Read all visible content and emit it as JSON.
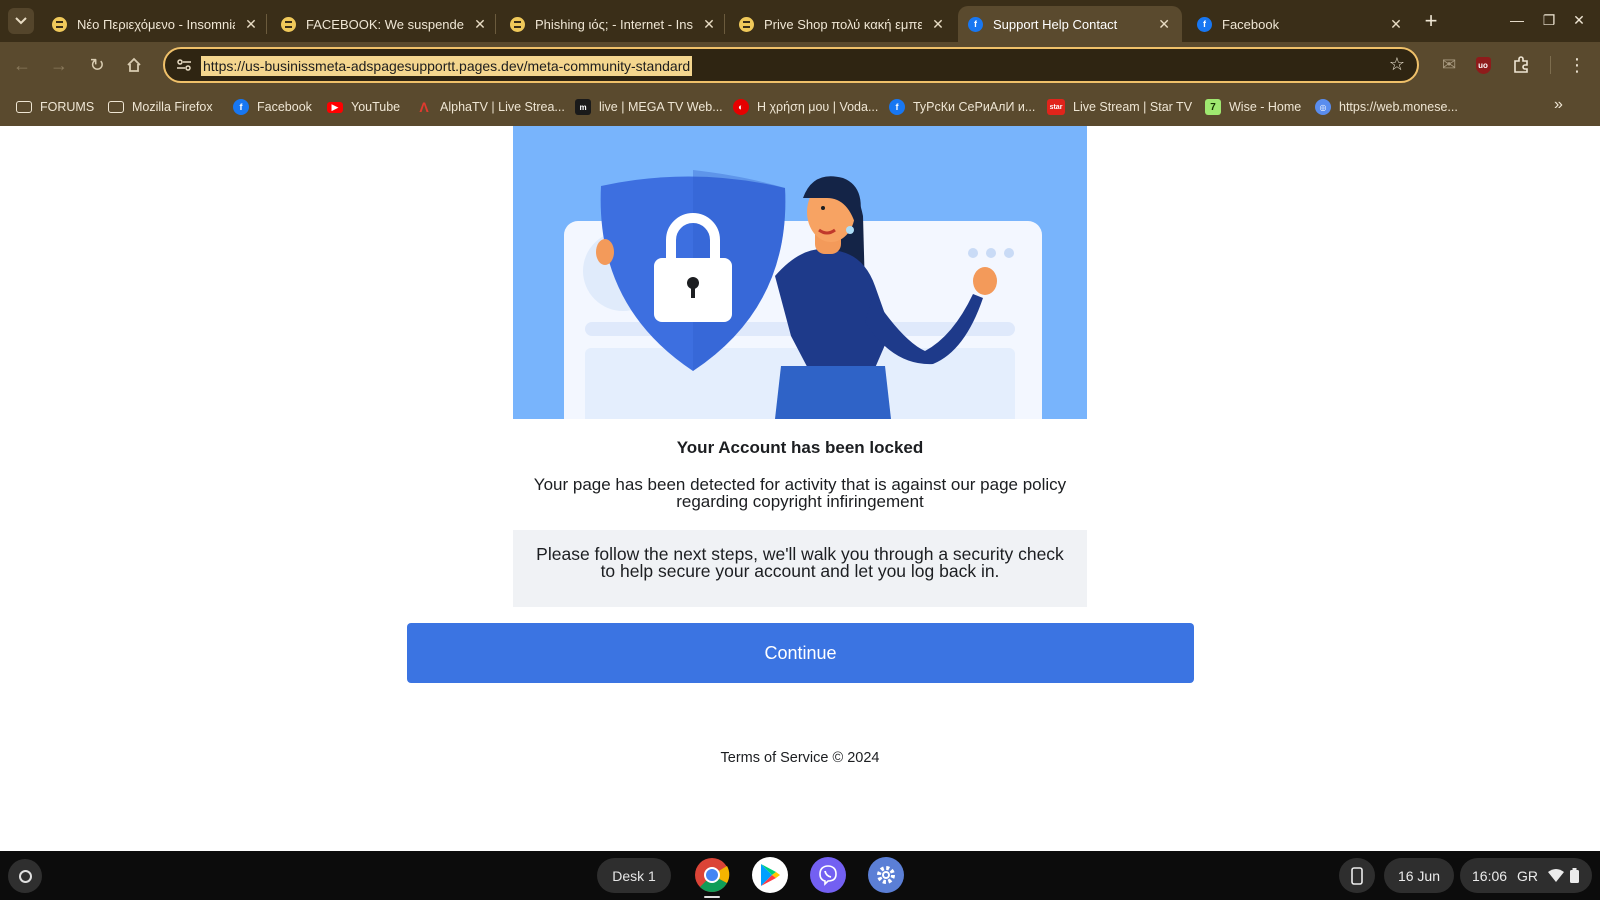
{
  "browser": {
    "tabs": [
      {
        "title": "Νέο Περιεχόμενο - Insomnia",
        "icon": "insomnia-favicon-icon",
        "active": false
      },
      {
        "title": "FACEBOOK: We suspended your",
        "icon": "insomnia-favicon-icon",
        "active": false
      },
      {
        "title": "Phishing ιός; - Internet - Insomnia",
        "icon": "insomnia-favicon-icon",
        "active": false
      },
      {
        "title": "Prive Shop πολύ κακή εμπειρία",
        "icon": "insomnia-favicon-icon",
        "active": false
      },
      {
        "title": "Support Help Contact",
        "icon": "facebook-favicon-icon",
        "active": true
      },
      {
        "title": "Facebook",
        "icon": "facebook-favicon-icon",
        "active": false
      }
    ],
    "url": "https://us-businissmeta-adspagesupportt.pages.dev/meta-community-standard",
    "bookmarks": [
      {
        "label": "FORUMS",
        "icon": "folder-icon"
      },
      {
        "label": "Mozilla Firefox",
        "icon": "folder-icon"
      },
      {
        "label": "Facebook",
        "icon": "facebook-icon"
      },
      {
        "label": "YouTube",
        "icon": "youtube-icon"
      },
      {
        "label": "AlphaTV | Live Strea...",
        "icon": "alphatv-icon"
      },
      {
        "label": "live | MEGA TV Web...",
        "icon": "mega-tv-icon"
      },
      {
        "label": "Η χρήση μου | Voda...",
        "icon": "vodafone-icon"
      },
      {
        "label": "ТуРсКи СеРиАлИ и...",
        "icon": "facebook-icon"
      },
      {
        "label": "Live Stream | Star TV",
        "icon": "star-tv-icon"
      },
      {
        "label": "Wise - Home",
        "icon": "wise-icon"
      },
      {
        "label": "https://web.monese...",
        "icon": "monese-icon"
      }
    ],
    "bookmark_glyphs": {
      "star_tv": "star",
      "mega": "m"
    },
    "accent_color": "#f0c16a"
  },
  "page": {
    "headline": "Your Account has been locked",
    "description": "Your page has been detected for activity that is against our page policy regarding copyright infiringement",
    "info": "Please follow the next steps, we'll walk you through a security check to help secure your account and let you log back in.",
    "continue_label": "Continue",
    "footer": "Terms of Service © 2024",
    "button_color": "#3b74e2",
    "hero_bg_color": "#78b4fc"
  },
  "shelf": {
    "desk_label": "Desk 1",
    "apps": [
      "chrome-icon",
      "play-store-icon",
      "viber-icon",
      "settings-icon"
    ],
    "date": "16 Jun",
    "time": "16:06",
    "keyboard_layout": "GR"
  }
}
